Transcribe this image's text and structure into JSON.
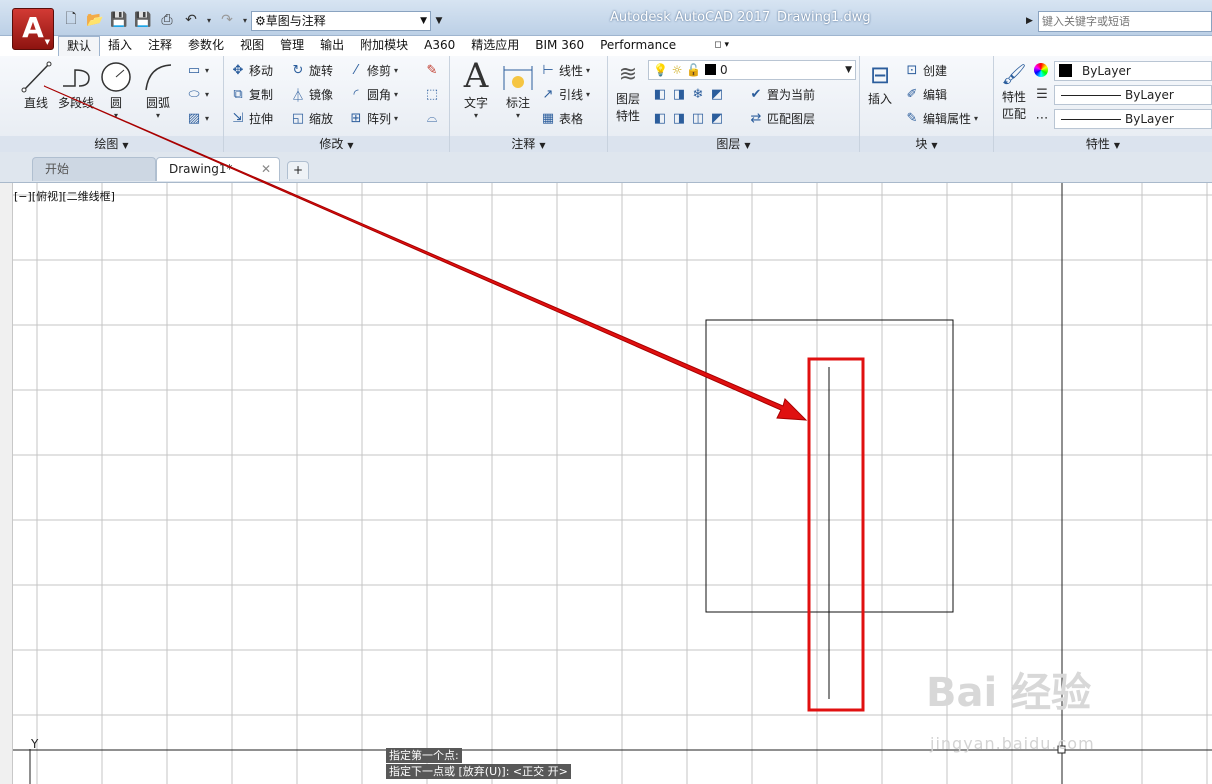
{
  "titlebar": {
    "app_logo": "A",
    "workspace": "草图与注释",
    "app_title": "Autodesk AutoCAD 2017",
    "file_title": "Drawing1.dwg",
    "search_placeholder": "键入关键字或短语"
  },
  "ribbon_tabs": [
    "默认",
    "插入",
    "注释",
    "参数化",
    "视图",
    "管理",
    "输出",
    "附加模块",
    "A360",
    "精选应用",
    "BIM 360",
    "Performance"
  ],
  "panels": {
    "draw": {
      "title": "绘图",
      "line": "直线",
      "polyline": "多段线",
      "circle": "圆",
      "arc": "圆弧"
    },
    "modify": {
      "title": "修改",
      "move": "移动",
      "rotate": "旋转",
      "trim": "修剪",
      "copy": "复制",
      "mirror": "镜像",
      "fillet": "圆角",
      "stretch": "拉伸",
      "scale": "缩放",
      "array": "阵列"
    },
    "annotation": {
      "title": "注释",
      "text": "文字",
      "dimension": "标注",
      "linear": "线性",
      "leader": "引线",
      "table": "表格"
    },
    "layers": {
      "title": "图层",
      "layer_props": "图层\n特性",
      "layer_props_a": "图层",
      "layer_props_b": "特性",
      "current_layer": "0",
      "set_current": "置为当前",
      "match_layer": "匹配图层"
    },
    "block": {
      "title": "块",
      "insert": "插入",
      "create": "创建",
      "edit": "编辑",
      "edit_attr": "编辑属性"
    },
    "properties": {
      "title": "特性",
      "match_a": "特性",
      "match_b": "匹配",
      "color": "ByLayer",
      "linetype": "ByLayer",
      "lineweight": "ByLayer"
    }
  },
  "doc_tabs": {
    "start": "开始",
    "drawing": "Drawing1*",
    "new": "+"
  },
  "viewport_label": "[−][俯视][二维线框]",
  "command": {
    "line1": "指定第一个点:",
    "line2": "指定下一点或 [放弃(U)]:  <正交 开>"
  },
  "ucs_label": "Y",
  "watermark": {
    "text": "Bai  经验",
    "url": "jingyan.baidu.com"
  },
  "colors": {
    "annotation_red": "#e01010",
    "app_red": "#c0281f"
  }
}
